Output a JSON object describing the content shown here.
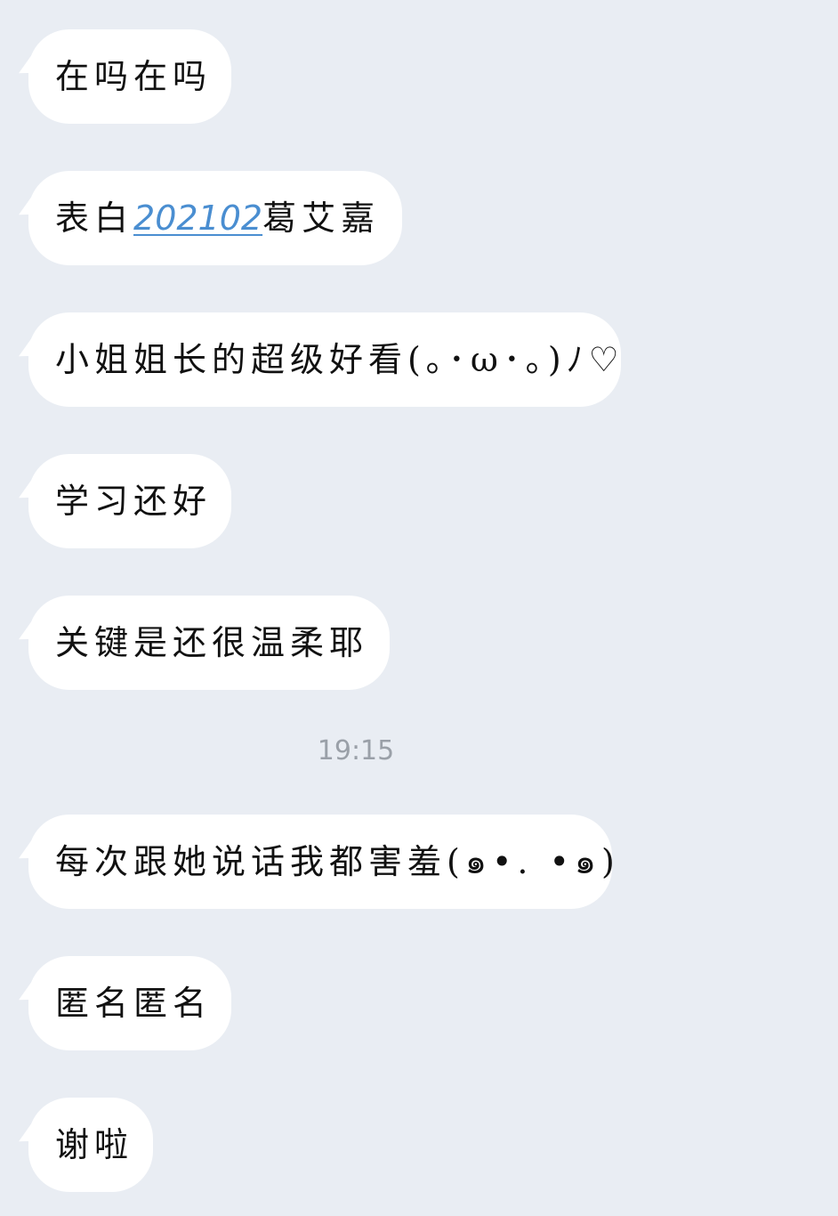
{
  "chat": {
    "messages": [
      {
        "text": "在吗在吗"
      },
      {
        "prefix": "表白",
        "link": "202102",
        "suffix": "葛艾嘉"
      },
      {
        "text": "小姐姐长的超级好看(｡･ω･｡)ﾉ♡"
      },
      {
        "text": "学习还好"
      },
      {
        "text": "关键是还很温柔耶"
      },
      {
        "text": "每次跟她说话我都害羞(๑•. •๑)"
      },
      {
        "text": "匿名匿名"
      },
      {
        "text": "谢啦"
      }
    ],
    "timestamp": "19:15"
  },
  "colors": {
    "background": "#e9edf3",
    "bubble": "#ffffff",
    "link": "#4a8ed1",
    "timestamp": "#9aa0a8"
  }
}
